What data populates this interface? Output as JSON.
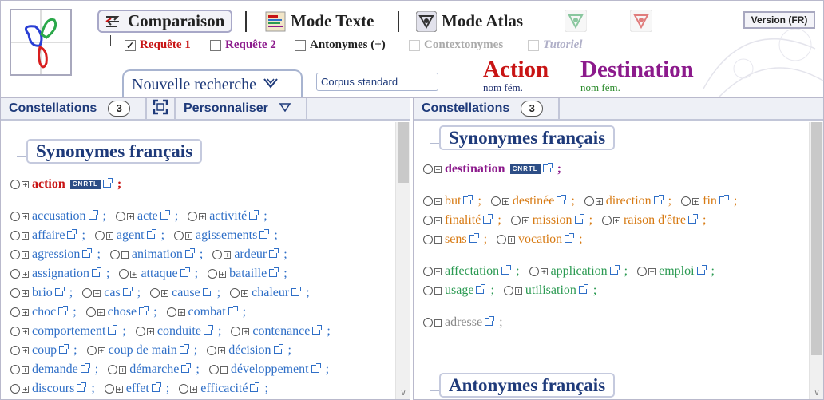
{
  "header": {
    "buttons": {
      "comparaison": "Comparaison",
      "mode_texte": "Mode Texte",
      "mode_atlas": "Mode Atlas"
    },
    "version": "Version (FR)",
    "options": {
      "requete1": "Requête 1",
      "requete2": "Requête 2",
      "antonymes": "Antonymes (+)",
      "contextonymes": "Contextonymes",
      "tutoriel": "Tutoriel"
    },
    "new_search": "Nouvelle recherche",
    "corpus": "Corpus standard",
    "word1": {
      "text": "Action",
      "category": "nom fém."
    },
    "word2": {
      "text": "Destination",
      "category": "nom fém."
    }
  },
  "left_panel": {
    "toolbar": {
      "constellations": "Constellations",
      "count": "3",
      "personnaliser": "Personnaliser"
    },
    "section_title": "Synonymes français",
    "head_word": "action",
    "cnrtl": "CNRTL",
    "rows": [
      [
        "accusation",
        "acte",
        "activité"
      ],
      [
        "affaire",
        "agent",
        "agissements"
      ],
      [
        "agression",
        "animation",
        "ardeur"
      ],
      [
        "assignation",
        "attaque",
        "bataille"
      ],
      [
        "brio",
        "cas",
        "cause",
        "chaleur"
      ],
      [
        "choc",
        "chose",
        "combat"
      ],
      [
        "comportement",
        "conduite",
        "contenance"
      ],
      [
        "coup",
        "coup de main",
        "décision"
      ],
      [
        "demande",
        "démarche",
        "développement"
      ],
      [
        "discours",
        "effet",
        "efficacité"
      ]
    ]
  },
  "right_panel": {
    "toolbar": {
      "constellations": "Constellations",
      "count": "3"
    },
    "section_title": "Synonymes français",
    "head_word": "destination",
    "cnrtl": "CNRTL",
    "orange_rows": [
      [
        "but",
        "destinée",
        "direction",
        "fin"
      ],
      [
        "finalité",
        "mission",
        "raison d'être"
      ],
      [
        "sens",
        "vocation"
      ]
    ],
    "green_rows": [
      [
        "affectation",
        "application",
        "emploi"
      ],
      [
        "usage",
        "utilisation"
      ]
    ],
    "grey_rows": [
      [
        "adresse"
      ]
    ],
    "antonymes_title": "Antonymes français"
  },
  "colors": {
    "requete1": "#c81414",
    "requete2": "#8c1a8c",
    "link_blue": "#2f6fc7",
    "orange": "#d77a13",
    "green": "#2b9a52",
    "grey": "#8a8a8a",
    "title_navy": "#1e3a7a"
  }
}
